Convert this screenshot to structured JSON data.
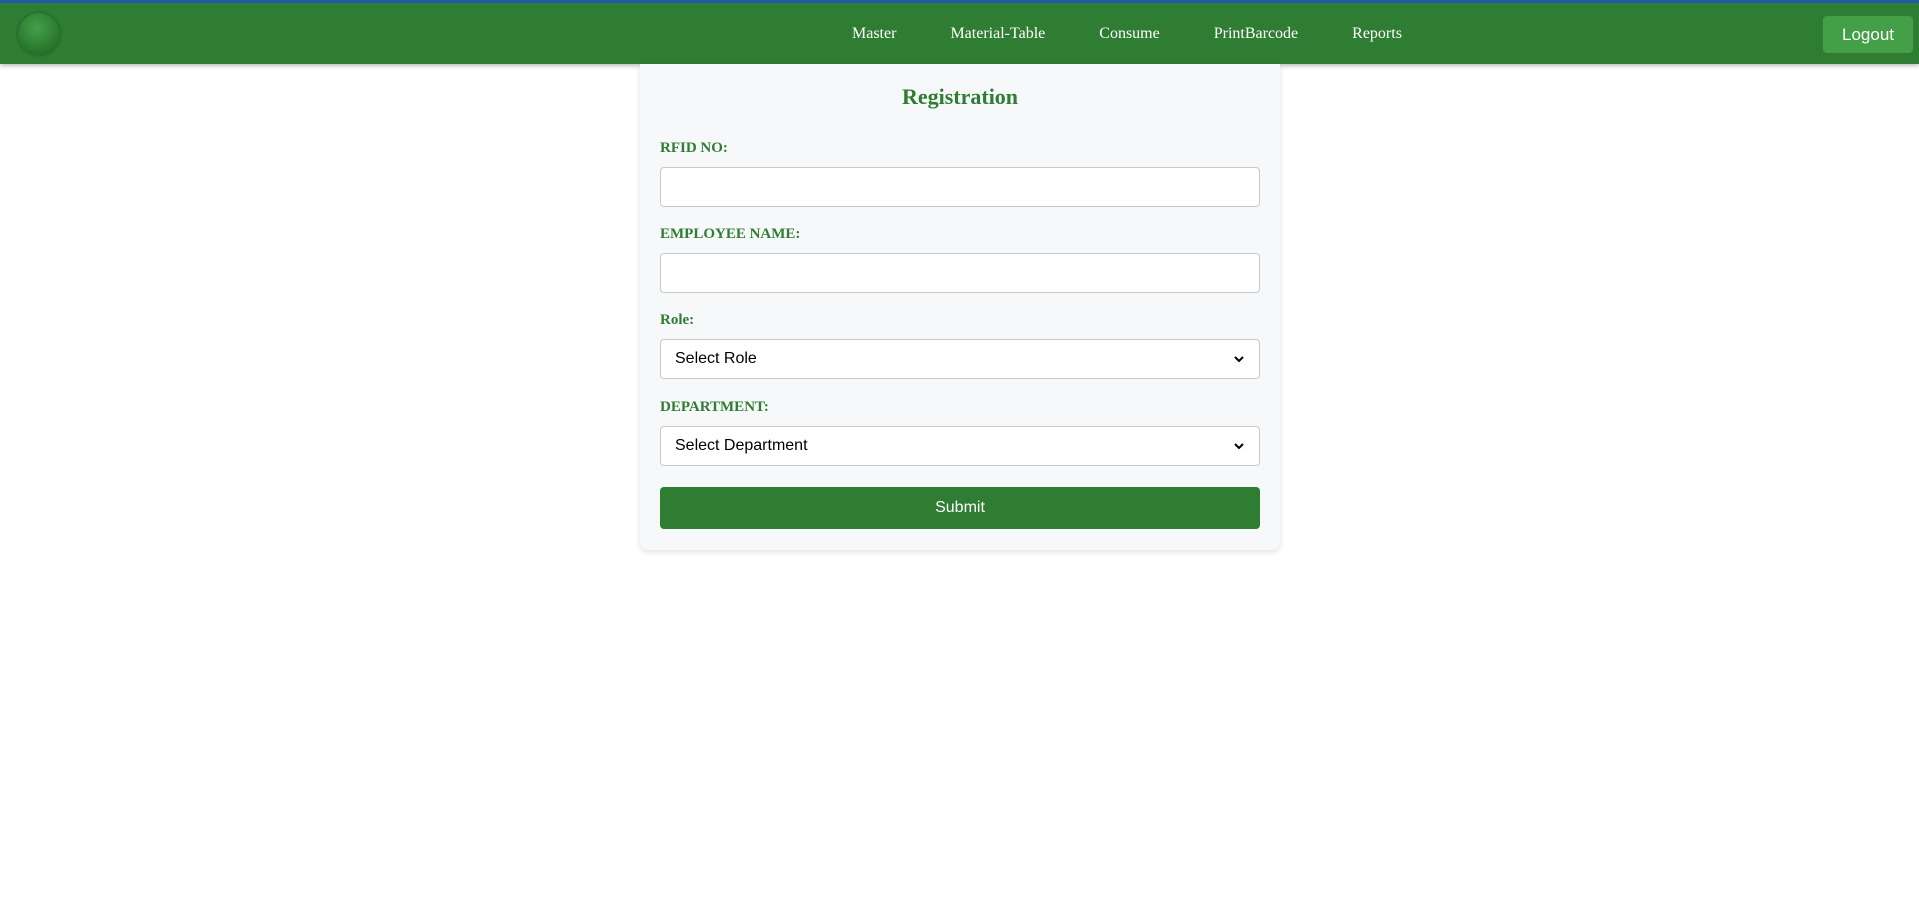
{
  "nav": {
    "items": [
      {
        "label": "Master"
      },
      {
        "label": "Material-Table"
      },
      {
        "label": "Consume"
      },
      {
        "label": "PrintBarcode"
      },
      {
        "label": "Reports"
      }
    ],
    "logout_label": "Logout",
    "logo_icon": "green-sphere-logo"
  },
  "form": {
    "title": "Registration",
    "rfid_label": "RFID NO:",
    "rfid_value": "",
    "employee_name_label": "EMPLOYEE NAME:",
    "employee_name_value": "",
    "role_label": "Role:",
    "role_selected": "Select Role",
    "department_label": "DEPARTMENT:",
    "department_selected": "Select Department",
    "submit_label": "Submit"
  },
  "colors": {
    "primary_green": "#2e7d32",
    "logout_green": "#43a047",
    "top_border_blue": "#1e5aa8",
    "card_background": "#f7f8f9"
  }
}
